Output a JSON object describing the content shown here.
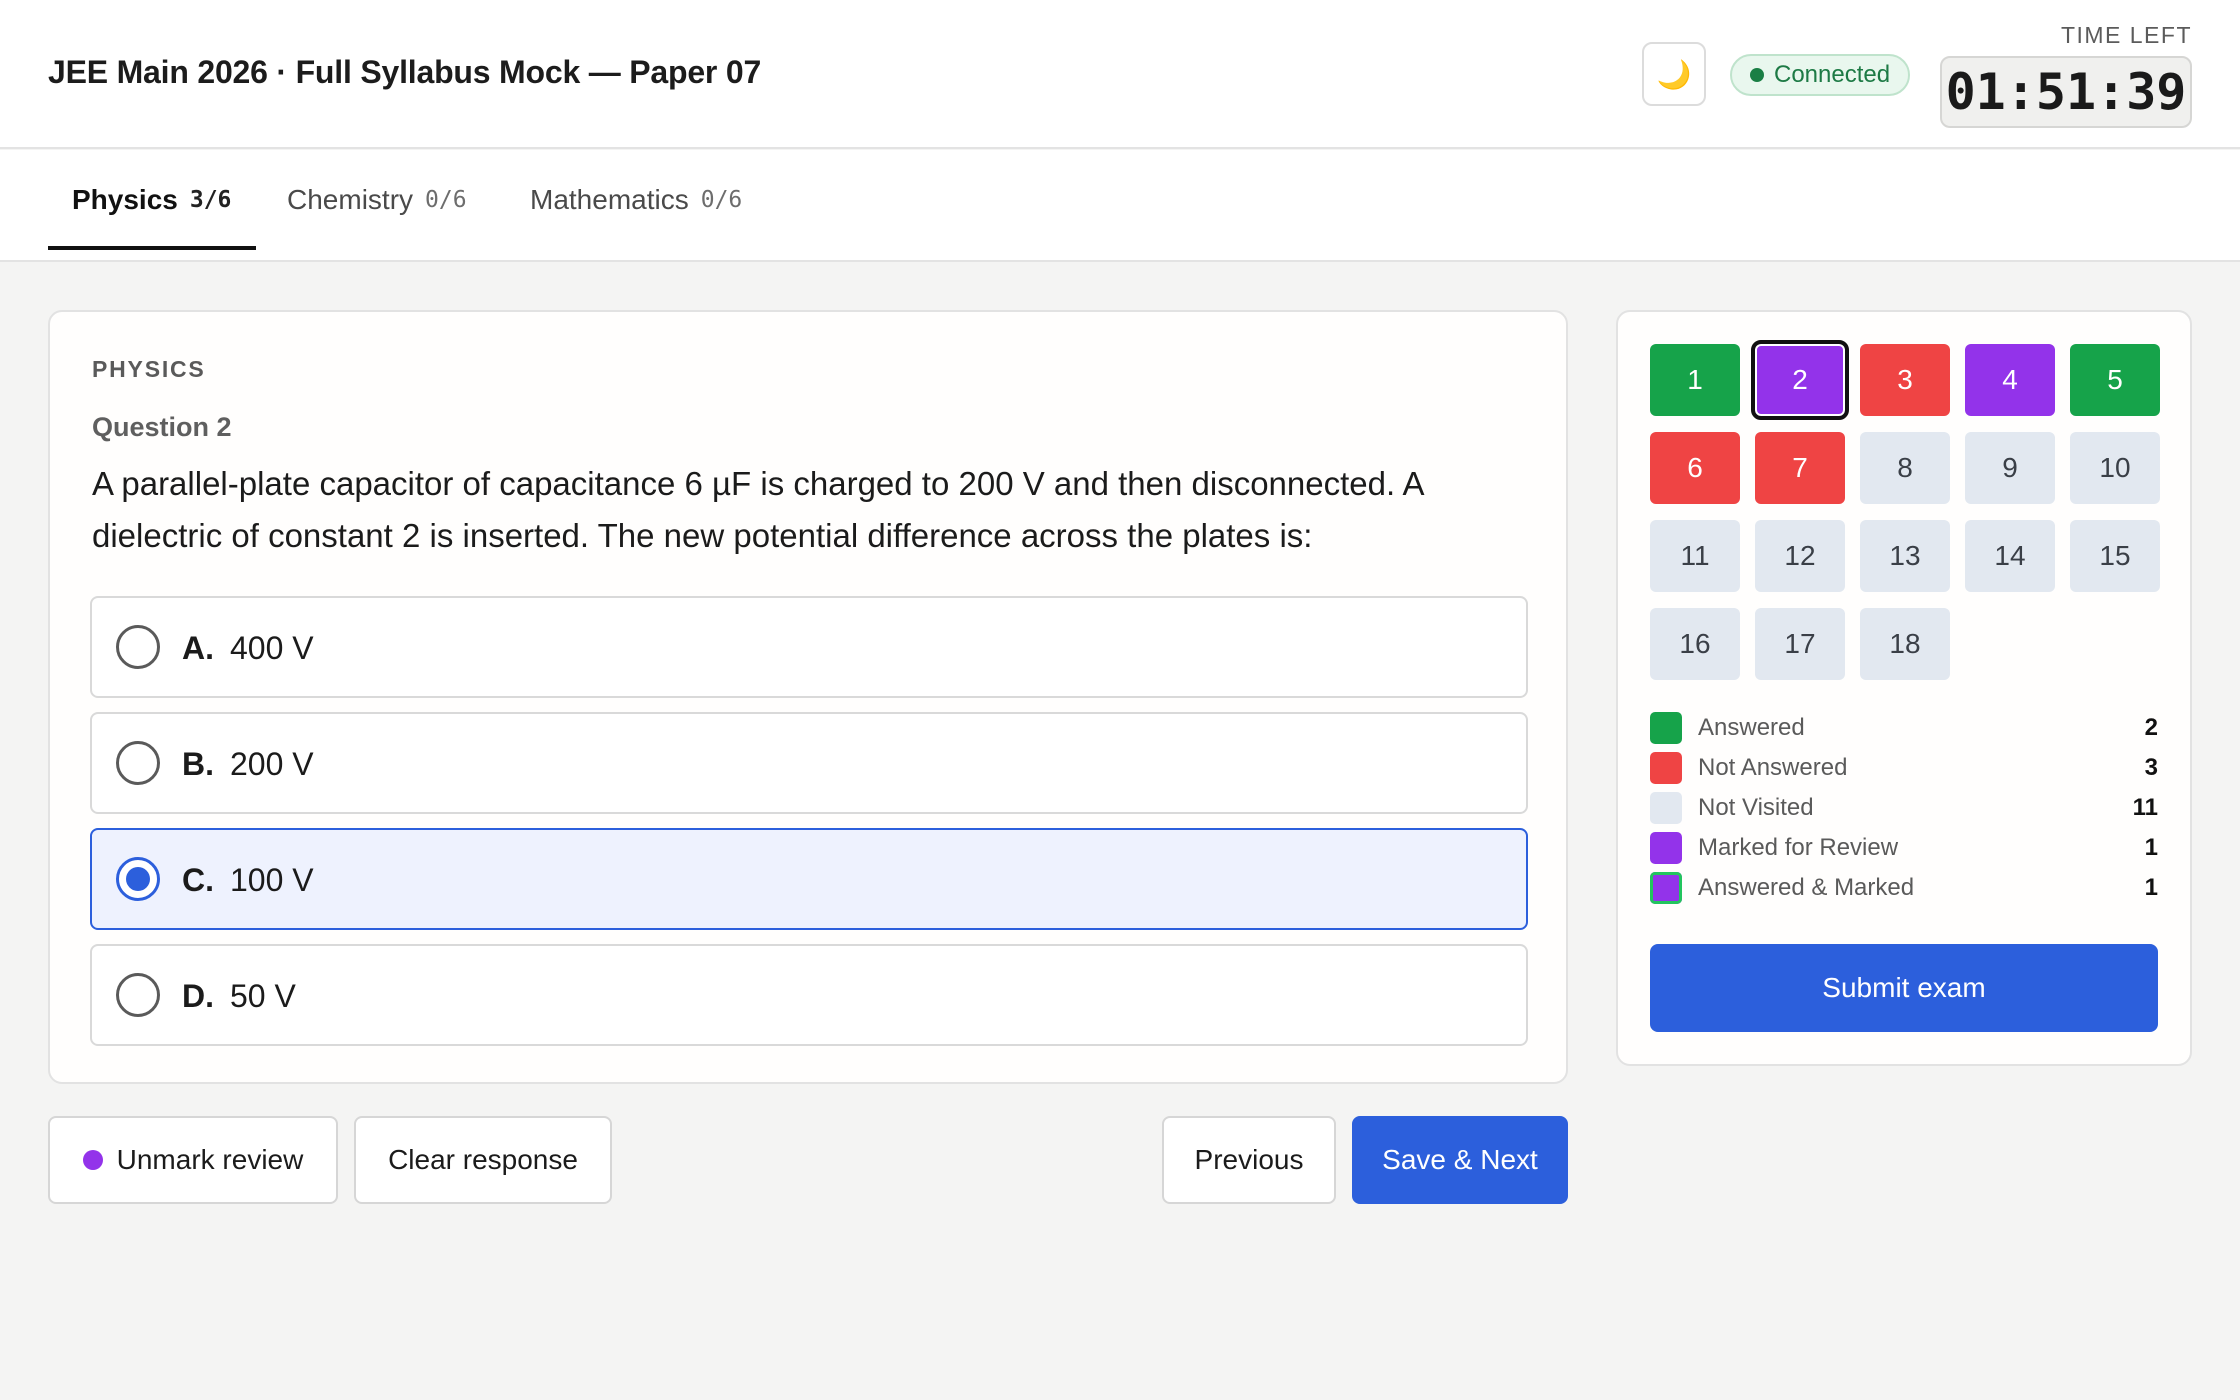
{
  "header": {
    "title": "JEE Main 2026 · Full Syllabus Mock — Paper 07",
    "theme_icon": "moon-icon",
    "connection_status": "Connected",
    "time_label": "TIME LEFT",
    "time_left": "01:51:39"
  },
  "tabs": [
    {
      "label": "Physics",
      "count": "3/6",
      "active": true
    },
    {
      "label": "Chemistry",
      "count": "0/6",
      "active": false
    },
    {
      "label": "Mathematics",
      "count": "0/6",
      "active": false
    }
  ],
  "question": {
    "subject": "PHYSICS",
    "number_label": "Question 2",
    "text": "A parallel-plate capacitor of capacitance 6 µF is charged to 200 V and then disconnected. A dielectric of constant 2 is inserted. The new potential difference across the plates is:",
    "options": [
      {
        "letter": "A.",
        "text": "400 V",
        "selected": false
      },
      {
        "letter": "B.",
        "text": "200 V",
        "selected": false
      },
      {
        "letter": "C.",
        "text": "100 V",
        "selected": true
      },
      {
        "letter": "D.",
        "text": "50 V",
        "selected": false
      }
    ]
  },
  "actions": {
    "unmark_review": "Unmark review",
    "clear_response": "Clear response",
    "previous": "Previous",
    "save_next": "Save & Next"
  },
  "palette": {
    "current": 2,
    "questions": [
      {
        "n": "1",
        "status": "answered"
      },
      {
        "n": "2",
        "status": "marked"
      },
      {
        "n": "3",
        "status": "not-answered"
      },
      {
        "n": "4",
        "status": "marked"
      },
      {
        "n": "5",
        "status": "answered"
      },
      {
        "n": "6",
        "status": "not-answered"
      },
      {
        "n": "7",
        "status": "not-answered"
      },
      {
        "n": "8",
        "status": "not-visited"
      },
      {
        "n": "9",
        "status": "not-visited"
      },
      {
        "n": "10",
        "status": "not-visited"
      },
      {
        "n": "11",
        "status": "not-visited"
      },
      {
        "n": "12",
        "status": "not-visited"
      },
      {
        "n": "13",
        "status": "not-visited"
      },
      {
        "n": "14",
        "status": "not-visited"
      },
      {
        "n": "15",
        "status": "not-visited"
      },
      {
        "n": "16",
        "status": "not-visited"
      },
      {
        "n": "17",
        "status": "not-visited"
      },
      {
        "n": "18",
        "status": "not-visited"
      }
    ],
    "legend": [
      {
        "label": "Answered",
        "count": "2",
        "color": "#16a34a"
      },
      {
        "label": "Not Answered",
        "count": "3",
        "color": "#ef4444"
      },
      {
        "label": "Not Visited",
        "count": "11",
        "color": "#e2e8f0"
      },
      {
        "label": "Marked for Review",
        "count": "1",
        "color": "#9333ea"
      },
      {
        "label": "Answered & Marked",
        "count": "1",
        "color": "#9333ea",
        "ring": "#22c55e"
      }
    ],
    "submit_label": "Submit exam"
  },
  "colors": {
    "primary": "#2c5fdc",
    "answered": "#16a34a",
    "not_answered": "#ef4444",
    "not_visited": "#e2e8f0",
    "marked": "#9333ea"
  }
}
